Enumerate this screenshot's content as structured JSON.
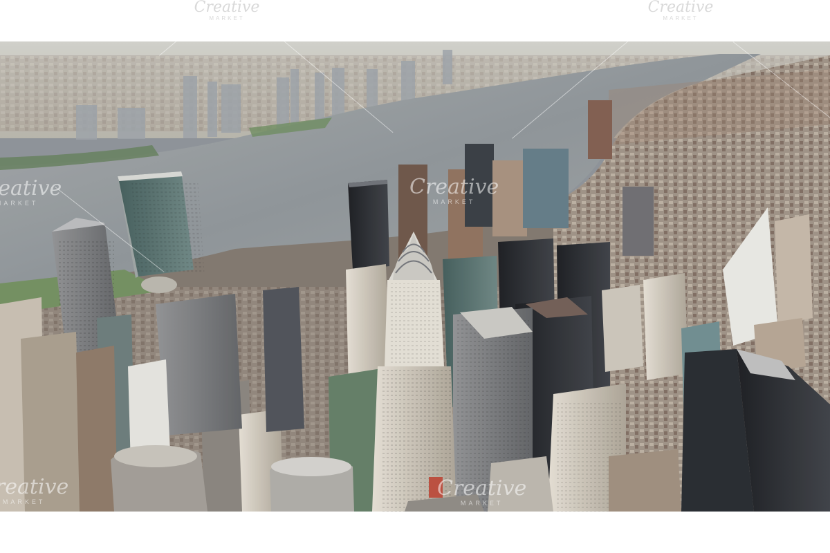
{
  "watermark": {
    "word": "Creative",
    "sub": "MARKET"
  },
  "colors": {
    "sky_haze": "#c9c9c3",
    "river": "#8e9397",
    "shadow": "#2d3034",
    "stone": "#c7bba6",
    "brick": "#8f6b57",
    "glass_green": "#4f6a67",
    "dark_tower": "#1d1f24"
  }
}
